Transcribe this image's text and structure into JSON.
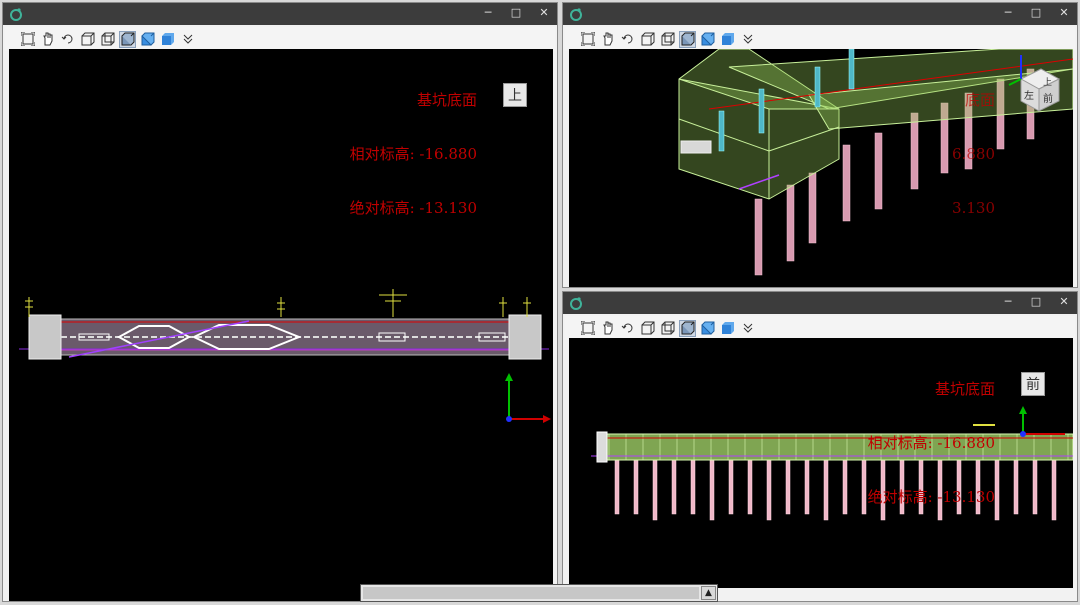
{
  "window_controls": {
    "minimize": "─",
    "maximize": "□",
    "close": "✕"
  },
  "toolbar_icons": [
    "zoom-extents-icon",
    "pan-hand-icon",
    "rotate-icon",
    "wireframe-box-icon",
    "hidden-line-box-icon",
    "shaded-edges-box-icon",
    "shaded-box-icon",
    "solid-box-icon",
    "more-chevron-icon"
  ],
  "active_tool": "shaded-edges-box-icon",
  "colors": {
    "title_bar": "#3c3c3c",
    "viewport_bg": "#000000",
    "info_text": "#c00000",
    "pile": "#d89ab0",
    "structure": "#b6e08a"
  },
  "left_viewport": {
    "info_line1": "基坑底面",
    "info_line2": "相对标高: -16.880",
    "info_line3": "绝对标高: -13.130",
    "view_cube_label": "上"
  },
  "top_right_viewport": {
    "info_line1": "底面",
    "info_line2": "6.880",
    "info_line3": "3.130",
    "view_cube_face_top": "上",
    "view_cube_face_left": "左",
    "view_cube_face_front": "前"
  },
  "bottom_right_viewport": {
    "info_line1": "基坑底面",
    "info_line2": "相对标高: -16.880",
    "info_line3": "绝对标高: -13.130",
    "view_cube_label": "前"
  },
  "scrollbar": {
    "arrow": "▲"
  }
}
